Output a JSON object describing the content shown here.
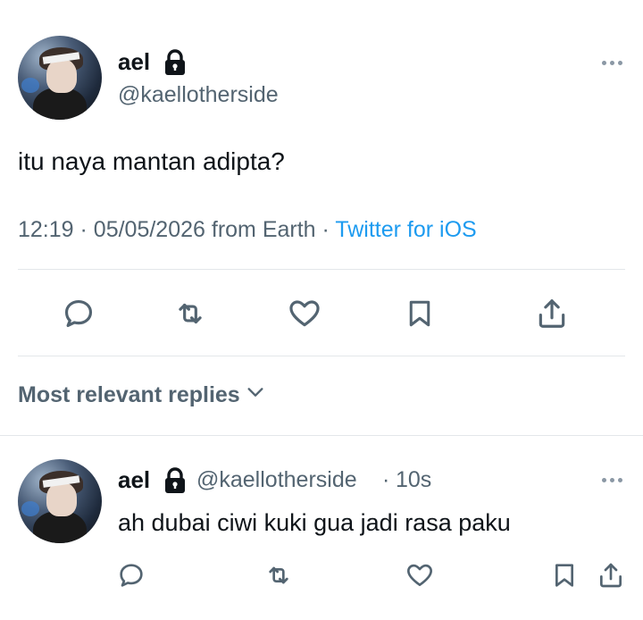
{
  "tweet": {
    "author_name": "ael",
    "author_handle": "@kaellotherside",
    "text": "itu naya mantan adipta?",
    "time": "12:19",
    "date": "05/05/2026",
    "location": "from Earth",
    "separator": "·",
    "source": "Twitter for iOS",
    "icons": [
      "lock-icon",
      "more-options-icon"
    ],
    "actions": [
      "reply-icon",
      "retweet-icon",
      "like-icon",
      "bookmark-icon",
      "share-icon"
    ]
  },
  "replies_section": {
    "label": "Most relevant replies",
    "icon": "chevron-down-icon"
  },
  "reply": {
    "author_name": "ael",
    "author_handle": "@kaellotherside",
    "separator": "·",
    "time_ago": "10s",
    "text": "ah dubai ciwi kuki gua jadi rasa paku",
    "icons": [
      "lock-icon",
      "more-options-icon"
    ],
    "actions": [
      "reply-icon",
      "retweet-icon",
      "like-icon",
      "bookmark-icon",
      "share-icon"
    ]
  },
  "colors": {
    "text": "#0f1419",
    "secondary": "#536471",
    "link": "#1d9bf0",
    "divider": "#e3e7ea"
  }
}
